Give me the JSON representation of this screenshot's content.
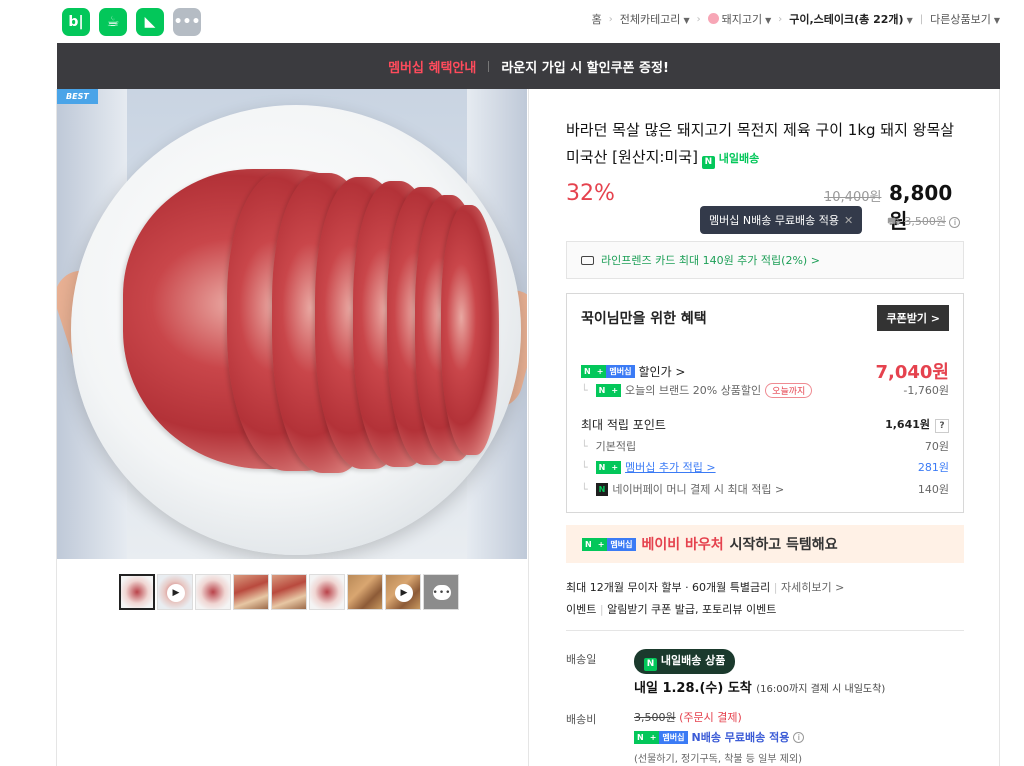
{
  "apps": [
    {
      "name": "blog",
      "glyph": "b|"
    },
    {
      "name": "cafe",
      "glyph": "☕"
    },
    {
      "name": "bookmark",
      "glyph": "◣"
    },
    {
      "name": "more",
      "glyph": "•••"
    }
  ],
  "breadcrumb": {
    "home": "홈",
    "category": "전체카테고리",
    "sub": "돼지고기",
    "current": "구이,스테이크(총 22개)",
    "other": "다른상품보기"
  },
  "banner": {
    "left": "멤버십 혜택안내",
    "right": "라운지 가입 시 할인쿠폰 증정!"
  },
  "badge_best": "BEST",
  "product": {
    "title": "바라던 목살 많은 돼지고기 목전지 제육 구이 1kg 돼지 왕목살 미국산 [원산지:미국]",
    "delivery_tag": "내일배송",
    "discount": "32%",
    "original_price": "10,400원",
    "price": "8,800원",
    "tooltip": "멤버십 N배송 무료배송 적용",
    "ship_old": "3,500원"
  },
  "card_promo": "라인프렌즈 카드 최대 140원 추가 적립(2%) >",
  "benefit": {
    "title": "꾹이님만을 위한 혜택",
    "coupon_btn": "쿠폰받기 >",
    "sale_label": "할인가 >",
    "sale_price": "7,040원",
    "brand_sale": "오늘의 브랜드 20% 상품할인",
    "brand_pill": "오늘까지",
    "brand_sale_amt": "-1,760원",
    "points_label": "최대 적립 포인트",
    "points_total": "1,641원",
    "basic_label": "기본적립",
    "basic_amt": "70원",
    "member_label": "멤버십 추가 적립 >",
    "member_amt": "281원",
    "pay_label": "네이버페이 머니 결제 시 최대 적립 >",
    "pay_amt": "140원"
  },
  "chips": {
    "n": "N",
    "plus": "+",
    "member": "멤버십"
  },
  "voucher": {
    "red": "베이비 바우처",
    "rest": "시작하고 득템해요"
  },
  "installment": {
    "text": "최대 12개월 무이자 할부 · 60개월 특별금리",
    "link": "자세히보기 >"
  },
  "event": {
    "label": "이벤트",
    "text": "알림받기 쿠폰 발급, 포토리뷰 이벤트"
  },
  "delivery": {
    "date_label": "배송일",
    "badge": "내일배송 상품",
    "arrive": "내일 1.28.(수) 도착",
    "arrive_note": "(16:00까지 결제 시 내일도착)",
    "fee_label": "배송비",
    "fee_old": "3,500원",
    "fee_pay": "(주문시 결제)",
    "free_text": "N배송 무료배송 적용",
    "note": "(선물하기, 정기구독, 착불 등 일부 제외)"
  }
}
